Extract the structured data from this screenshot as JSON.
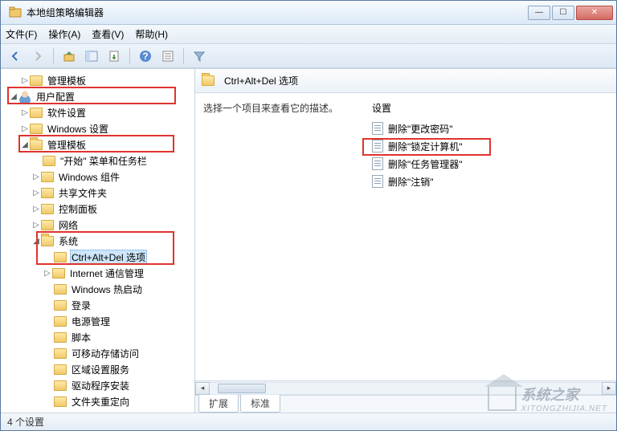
{
  "window": {
    "title": "本地组策略编辑器"
  },
  "menu": {
    "file": "文件(F)",
    "action": "操作(A)",
    "view": "查看(V)",
    "help": "帮助(H)"
  },
  "tree": {
    "guanlimoban_top": "管理模板",
    "userconfig": "用户配置",
    "softwaresettings": "软件设置",
    "windowssettings": "Windows 设置",
    "guanlimoban": "管理模板",
    "startmenu": "\"开始\" 菜单和任务栏",
    "wincomponents": "Windows 组件",
    "sharedfolders": "共享文件夹",
    "controlpanel": "控制面板",
    "network": "网络",
    "system": "系统",
    "ctrlaltdel": "Ctrl+Alt+Del 选项",
    "internetcomm": "Internet 通信管理",
    "winhotstart": "Windows 热启动",
    "login": "登录",
    "powermgmt": "电源管理",
    "script": "脚本",
    "removable": "可移动存储访问",
    "domainservice": "区域设置服务",
    "driverinstall": "驱动程序安装",
    "folderredir": "文件夹重定向"
  },
  "right": {
    "header": "Ctrl+Alt+Del 选项",
    "desc": "选择一个项目来查看它的描述。",
    "settings_hdr": "设置",
    "items": {
      "a": "删除\"更改密码\"",
      "b": "删除\"锁定计算机\"",
      "c": "删除\"任务管理器\"",
      "d": "删除\"注销\""
    }
  },
  "tabs": {
    "extended": "扩展",
    "standard": "标准"
  },
  "status": "4 个设置",
  "watermark": {
    "name": "系统之家",
    "url": "XITONGZHIJIA.NET"
  }
}
